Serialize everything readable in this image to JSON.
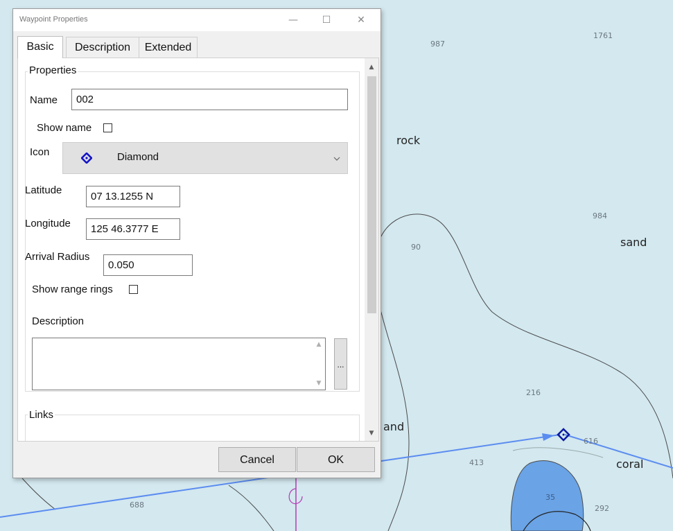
{
  "window": {
    "title": "Waypoint Properties",
    "minimize_glyph": "—",
    "maximize_glyph": "☐",
    "close_glyph": "✕"
  },
  "tabs": [
    {
      "label": "Basic",
      "active": true
    },
    {
      "label": "Description",
      "active": false
    },
    {
      "label": "Extended",
      "active": false
    }
  ],
  "properties": {
    "legend": "Properties",
    "name_label": "Name",
    "name_value": "002",
    "show_name_label": "Show name",
    "show_name_checked": false,
    "icon_label": "Icon",
    "icon_value": "Diamond",
    "icon_name": "diamond-icon",
    "latitude_label": "Latitude",
    "latitude_value": "07 13.1255 N",
    "longitude_label": "Longitude",
    "longitude_value": "125 46.3777 E",
    "arrival_radius_label": "Arrival Radius",
    "arrival_radius_value": "0.050",
    "show_range_rings_label": "Show range rings",
    "show_range_rings_checked": false,
    "description_label": "Description",
    "description_value": "",
    "ellipsis_label": "..."
  },
  "links": {
    "legend": "Links"
  },
  "buttons": {
    "cancel": "Cancel",
    "ok": "OK"
  },
  "chart": {
    "depths": [
      "987",
      "1761",
      "984",
      "90",
      "216",
      "616",
      "413",
      "35",
      "292",
      "688"
    ],
    "seabed_labels": [
      "rock",
      "sand",
      "and",
      "coral"
    ],
    "route_color": "#5b8cf0",
    "waypoint_color": "#0c1aa0",
    "shoal_color": "#6aa3e6",
    "sea_color": "#d3e8ef"
  },
  "colors": {
    "accent": "#1515c8"
  }
}
